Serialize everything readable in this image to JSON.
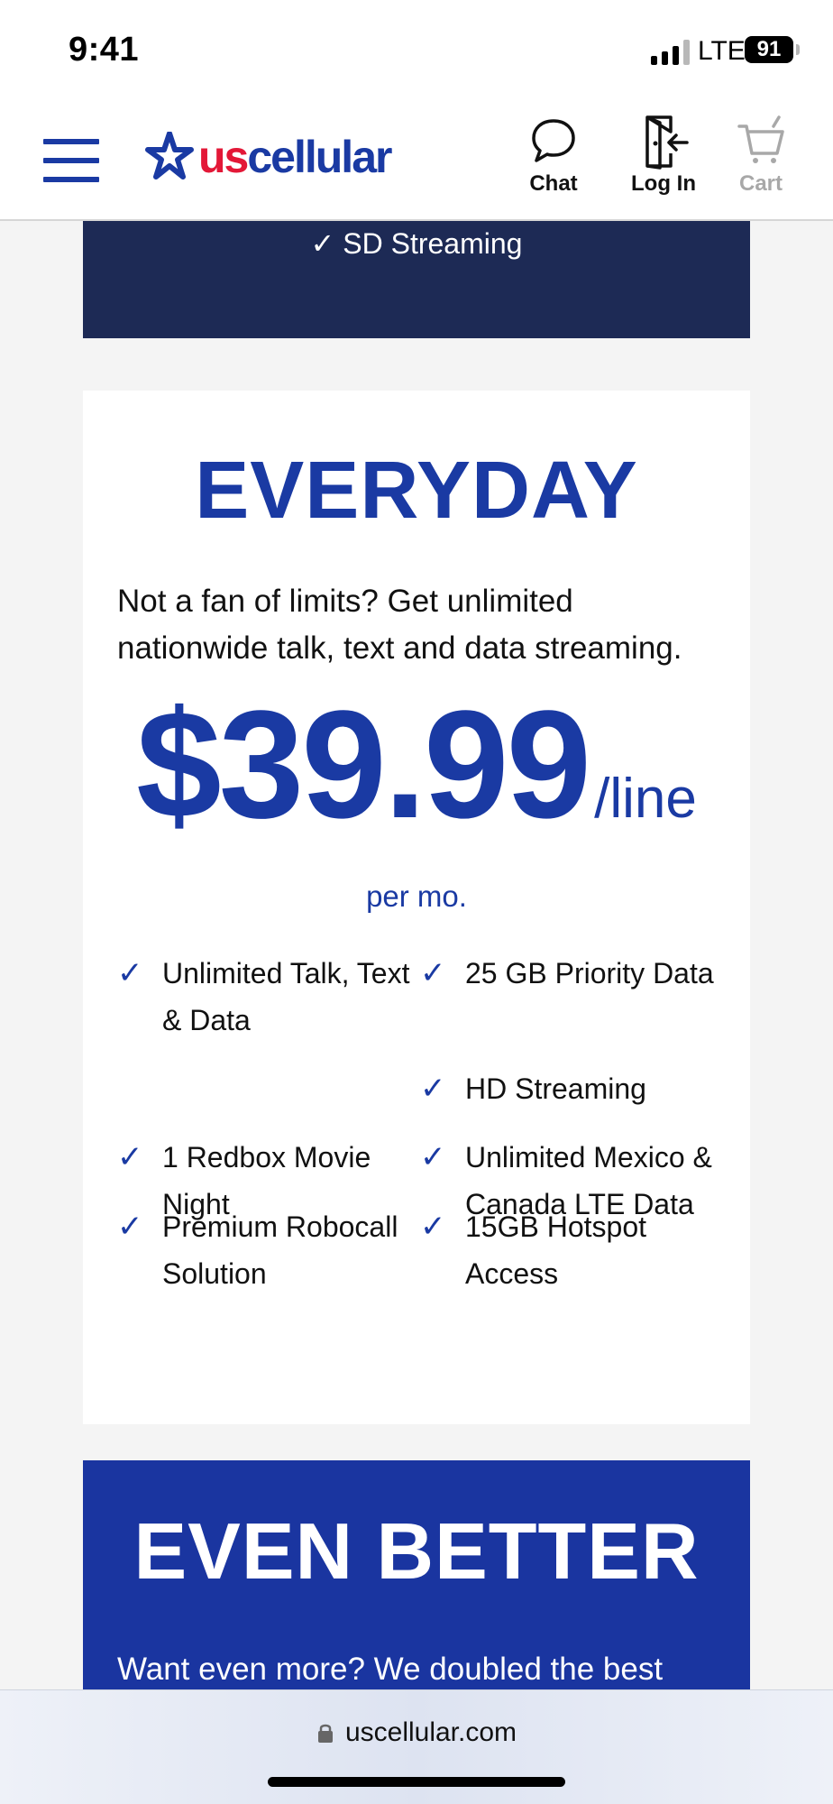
{
  "status_bar": {
    "time": "9:41",
    "network": "LTE",
    "battery": "91"
  },
  "header": {
    "logo": {
      "us": "us",
      "cellular": "cellular"
    },
    "chat_label": "Chat",
    "login_label": "Log In",
    "cart_label": "Cart"
  },
  "prev_plan": {
    "feature": "SD Streaming"
  },
  "plan": {
    "name": "EVERYDAY",
    "description": "Not a fan of limits? Get unlimited nationwide talk, text and data streaming.",
    "price": "$39.99",
    "unit": "/line",
    "period": "per mo.",
    "features": [
      "Unlimited Talk, Text & Data",
      "25 GB Priority Data",
      "HD Streaming",
      "1 Redbox Movie Night",
      "Unlimited Mexico & Canada LTE Data",
      "Premium Robocall Solution",
      "15GB Hotspot Access"
    ]
  },
  "next_plan": {
    "name": "EVEN BETTER",
    "description": "Want even more? We doubled the best"
  },
  "browser": {
    "url": "uscellular.com"
  },
  "colors": {
    "brand_blue": "#1a3aa3",
    "dark_navy": "#1d2a55",
    "brand_red": "#e31837"
  }
}
